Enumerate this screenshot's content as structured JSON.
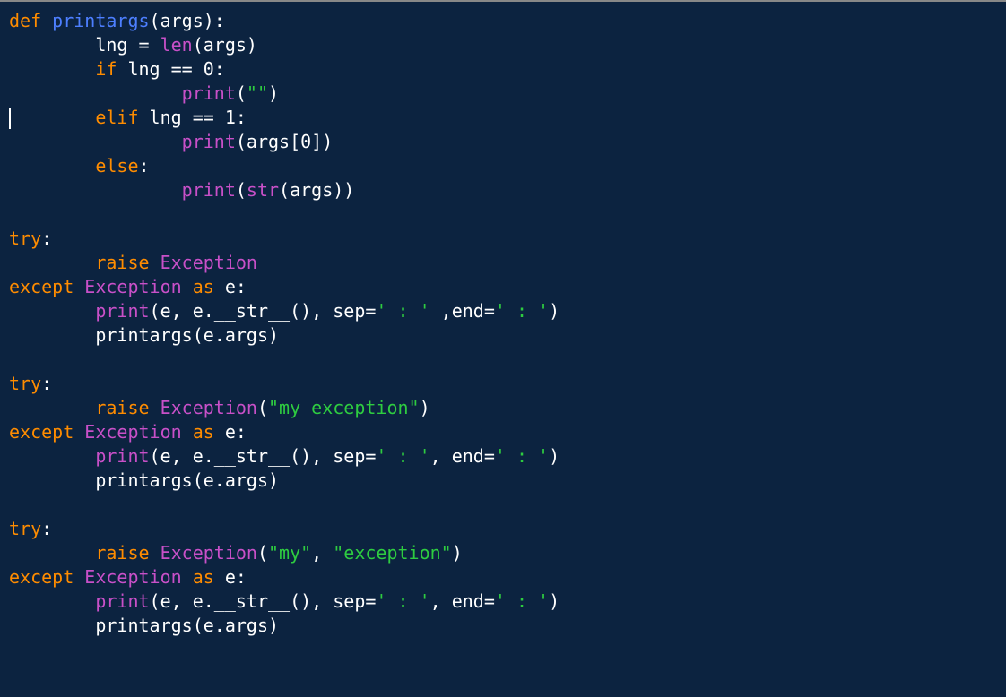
{
  "code": {
    "lines": [
      {
        "indent": 0,
        "tokens": [
          {
            "t": "def ",
            "c": "kw-def"
          },
          {
            "t": "printargs",
            "c": "funcname"
          },
          {
            "t": "(args):",
            "c": "punct"
          }
        ]
      },
      {
        "indent": 8,
        "tokens": [
          {
            "t": "lng ",
            "c": "ident"
          },
          {
            "t": "= ",
            "c": "op"
          },
          {
            "t": "len",
            "c": "builtin"
          },
          {
            "t": "(args)",
            "c": "punct"
          }
        ]
      },
      {
        "indent": 8,
        "tokens": [
          {
            "t": "if ",
            "c": "kw-if"
          },
          {
            "t": "lng ",
            "c": "ident"
          },
          {
            "t": "== ",
            "c": "op"
          },
          {
            "t": "0",
            "c": "number"
          },
          {
            "t": ":",
            "c": "punct"
          }
        ]
      },
      {
        "indent": 16,
        "tokens": [
          {
            "t": "print",
            "c": "builtin"
          },
          {
            "t": "(",
            "c": "punct"
          },
          {
            "t": "\"\"",
            "c": "string"
          },
          {
            "t": ")",
            "c": "punct"
          }
        ]
      },
      {
        "indent": 8,
        "tokens": [
          {
            "t": "elif ",
            "c": "kw-elif"
          },
          {
            "t": "lng ",
            "c": "ident"
          },
          {
            "t": "== ",
            "c": "op"
          },
          {
            "t": "1",
            "c": "number"
          },
          {
            "t": ":",
            "c": "punct"
          }
        ]
      },
      {
        "indent": 16,
        "tokens": [
          {
            "t": "print",
            "c": "builtin"
          },
          {
            "t": "(args[",
            "c": "punct"
          },
          {
            "t": "0",
            "c": "number"
          },
          {
            "t": "])",
            "c": "punct"
          }
        ]
      },
      {
        "indent": 8,
        "tokens": [
          {
            "t": "else",
            "c": "kw-else"
          },
          {
            "t": ":",
            "c": "punct"
          }
        ]
      },
      {
        "indent": 16,
        "tokens": [
          {
            "t": "print",
            "c": "builtin"
          },
          {
            "t": "(",
            "c": "punct"
          },
          {
            "t": "str",
            "c": "builtin-type"
          },
          {
            "t": "(args))",
            "c": "punct"
          }
        ]
      },
      {
        "indent": 0,
        "tokens": []
      },
      {
        "indent": 0,
        "tokens": [
          {
            "t": "try",
            "c": "kw-try"
          },
          {
            "t": ":",
            "c": "punct"
          }
        ]
      },
      {
        "indent": 8,
        "tokens": [
          {
            "t": "raise ",
            "c": "kw-raise"
          },
          {
            "t": "Exception",
            "c": "builtin-type"
          }
        ]
      },
      {
        "indent": 0,
        "tokens": [
          {
            "t": "except ",
            "c": "kw-except"
          },
          {
            "t": "Exception ",
            "c": "builtin-type"
          },
          {
            "t": "as ",
            "c": "kw-as"
          },
          {
            "t": "e:",
            "c": "ident"
          }
        ]
      },
      {
        "indent": 8,
        "tokens": [
          {
            "t": "print",
            "c": "builtin"
          },
          {
            "t": "(e, e.__str__(), sep=",
            "c": "punct"
          },
          {
            "t": "' : '",
            "c": "string"
          },
          {
            "t": " ,end=",
            "c": "punct"
          },
          {
            "t": "' : '",
            "c": "string"
          },
          {
            "t": ")",
            "c": "punct"
          }
        ]
      },
      {
        "indent": 8,
        "tokens": [
          {
            "t": "printargs(e.args)",
            "c": "ident"
          }
        ]
      },
      {
        "indent": 0,
        "tokens": []
      },
      {
        "indent": 0,
        "tokens": [
          {
            "t": "try",
            "c": "kw-try"
          },
          {
            "t": ":",
            "c": "punct"
          }
        ]
      },
      {
        "indent": 8,
        "tokens": [
          {
            "t": "raise ",
            "c": "kw-raise"
          },
          {
            "t": "Exception",
            "c": "builtin-type"
          },
          {
            "t": "(",
            "c": "punct"
          },
          {
            "t": "\"my exception\"",
            "c": "string"
          },
          {
            "t": ")",
            "c": "punct"
          }
        ]
      },
      {
        "indent": 0,
        "tokens": [
          {
            "t": "except ",
            "c": "kw-except"
          },
          {
            "t": "Exception ",
            "c": "builtin-type"
          },
          {
            "t": "as ",
            "c": "kw-as"
          },
          {
            "t": "e:",
            "c": "ident"
          }
        ]
      },
      {
        "indent": 8,
        "tokens": [
          {
            "t": "print",
            "c": "builtin"
          },
          {
            "t": "(e, e.__str__(), sep=",
            "c": "punct"
          },
          {
            "t": "' : '",
            "c": "string"
          },
          {
            "t": ", end=",
            "c": "punct"
          },
          {
            "t": "' : '",
            "c": "string"
          },
          {
            "t": ")",
            "c": "punct"
          }
        ]
      },
      {
        "indent": 8,
        "tokens": [
          {
            "t": "printargs(e.args)",
            "c": "ident"
          }
        ]
      },
      {
        "indent": 0,
        "tokens": []
      },
      {
        "indent": 0,
        "tokens": [
          {
            "t": "try",
            "c": "kw-try"
          },
          {
            "t": ":",
            "c": "punct"
          }
        ]
      },
      {
        "indent": 8,
        "tokens": [
          {
            "t": "raise ",
            "c": "kw-raise"
          },
          {
            "t": "Exception",
            "c": "builtin-type"
          },
          {
            "t": "(",
            "c": "punct"
          },
          {
            "t": "\"my\"",
            "c": "string"
          },
          {
            "t": ", ",
            "c": "punct"
          },
          {
            "t": "\"exception\"",
            "c": "string"
          },
          {
            "t": ")",
            "c": "punct"
          }
        ]
      },
      {
        "indent": 0,
        "tokens": [
          {
            "t": "except ",
            "c": "kw-except"
          },
          {
            "t": "Exception ",
            "c": "builtin-type"
          },
          {
            "t": "as ",
            "c": "kw-as"
          },
          {
            "t": "e:",
            "c": "ident"
          }
        ]
      },
      {
        "indent": 8,
        "tokens": [
          {
            "t": "print",
            "c": "builtin"
          },
          {
            "t": "(e, e.__str__(), sep=",
            "c": "punct"
          },
          {
            "t": "' : '",
            "c": "string"
          },
          {
            "t": ", end=",
            "c": "punct"
          },
          {
            "t": "' : '",
            "c": "string"
          },
          {
            "t": ")",
            "c": "punct"
          }
        ]
      },
      {
        "indent": 8,
        "tokens": [
          {
            "t": "printargs(e.args)",
            "c": "ident"
          }
        ]
      }
    ]
  },
  "cursor": {
    "line": 4,
    "col": 0
  }
}
